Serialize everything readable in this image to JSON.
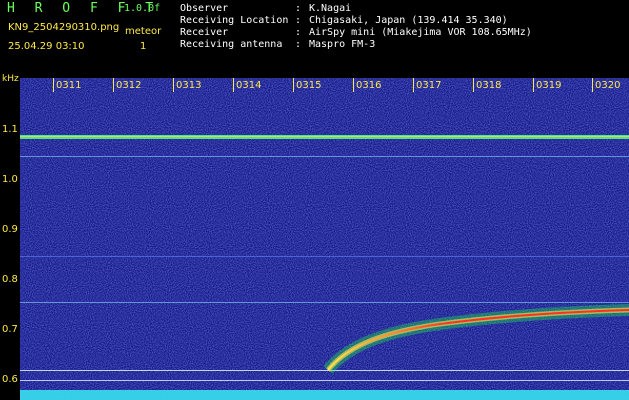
{
  "header": {
    "brand": "H R O F F T",
    "version": "1.0.0f",
    "filename": "KN9_2504290310.png",
    "timestamp": "25.04.29 03:10",
    "meteor_label": "meteor",
    "meteor_count": "1"
  },
  "meta": [
    {
      "key": "Observer",
      "value": "K.Nagai"
    },
    {
      "key": "Receiving Location",
      "value": "Chigasaki, Japan (139.414 35.340)"
    },
    {
      "key": "Receiver",
      "value": "AirSpy mini (Miakejima VOR 108.65MHz)"
    },
    {
      "key": "Receiving antenna",
      "value": "Maspro FM-3"
    }
  ],
  "axis": {
    "y_unit": "kHz",
    "y_labels": [
      "1.1",
      "1.0",
      "0.9",
      "0.8",
      "0.7",
      "0.6"
    ],
    "x_labels": [
      "0311",
      "0312",
      "0313",
      "0314",
      "0315",
      "0316",
      "0317",
      "0318",
      "0319",
      "0320"
    ]
  },
  "colors": {
    "background": "#1a1a8a",
    "noise": "#3a56d8",
    "carrier": "#5dff8a",
    "meteor_core": "#ff3020",
    "label": "#ffe94a"
  }
}
